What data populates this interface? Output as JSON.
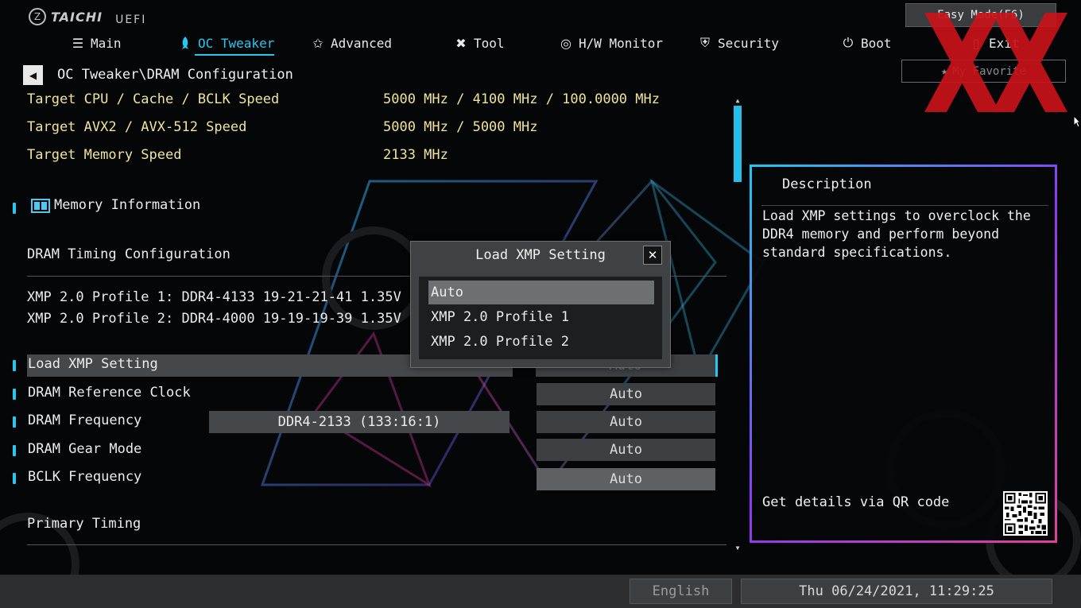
{
  "logo": {
    "brand": "TAICHI",
    "sub": "UEFI"
  },
  "nav": {
    "items": [
      {
        "label": "Main",
        "icon": "list-icon"
      },
      {
        "label": "OC Tweaker",
        "icon": "rocket-icon"
      },
      {
        "label": "Advanced",
        "icon": "star-icon"
      },
      {
        "label": "Tool",
        "icon": "tools-icon"
      },
      {
        "label": "H/W Monitor",
        "icon": "monitor-icon"
      },
      {
        "label": "Security",
        "icon": "shield-icon"
      },
      {
        "label": "Boot",
        "icon": "power-icon"
      },
      {
        "label": "Exit",
        "icon": "exit-icon"
      }
    ],
    "active": "OC Tweaker",
    "easy_mode": "Easy Mode(F6)",
    "favorite": "My Favorite"
  },
  "breadcrumb": "OC Tweaker\\DRAM Configuration",
  "targets": [
    {
      "label": "Target CPU / Cache / BCLK Speed",
      "value": "5000 MHz / 4100 MHz / 100.0000 MHz"
    },
    {
      "label": "Target AVX2 / AVX-512 Speed",
      "value": "5000 MHz / 5000 MHz"
    },
    {
      "label": "Target Memory Speed",
      "value": "2133 MHz"
    }
  ],
  "memory_info": "Memory Information",
  "timing_section": "DRAM Timing Configuration",
  "profiles": [
    "XMP 2.0 Profile 1: DDR4-4133 19-21-21-41 1.35V",
    "XMP 2.0 Profile 2: DDR4-4000 19-19-19-39 1.35V"
  ],
  "settings": [
    {
      "label": "Load XMP Setting",
      "value": "Auto"
    },
    {
      "label": "DRAM Reference Clock",
      "value": "Auto"
    },
    {
      "label": "DRAM Frequency",
      "current": "DDR4-2133 (133:16:1)",
      "value": "Auto"
    },
    {
      "label": "DRAM Gear Mode",
      "value": "Auto"
    },
    {
      "label": "BCLK Frequency",
      "value": "Auto"
    }
  ],
  "primary_timing": "Primary Timing",
  "description": {
    "title": "Description",
    "text": "Load XMP settings to overclock the DDR4 memory and perform beyond standard specifications.",
    "qr_label": "Get details via QR code"
  },
  "popup": {
    "title": "Load XMP Setting",
    "options": [
      "Auto",
      "XMP 2.0 Profile 1",
      "XMP 2.0 Profile 2"
    ],
    "selected": "Auto"
  },
  "footer": {
    "language": "English",
    "datetime": "Thu 06/24/2021, 11:29:25"
  },
  "colors": {
    "accent": "#29c7f0",
    "label_yellow": "#f0e49a",
    "watermark_red": "#c8141a"
  }
}
